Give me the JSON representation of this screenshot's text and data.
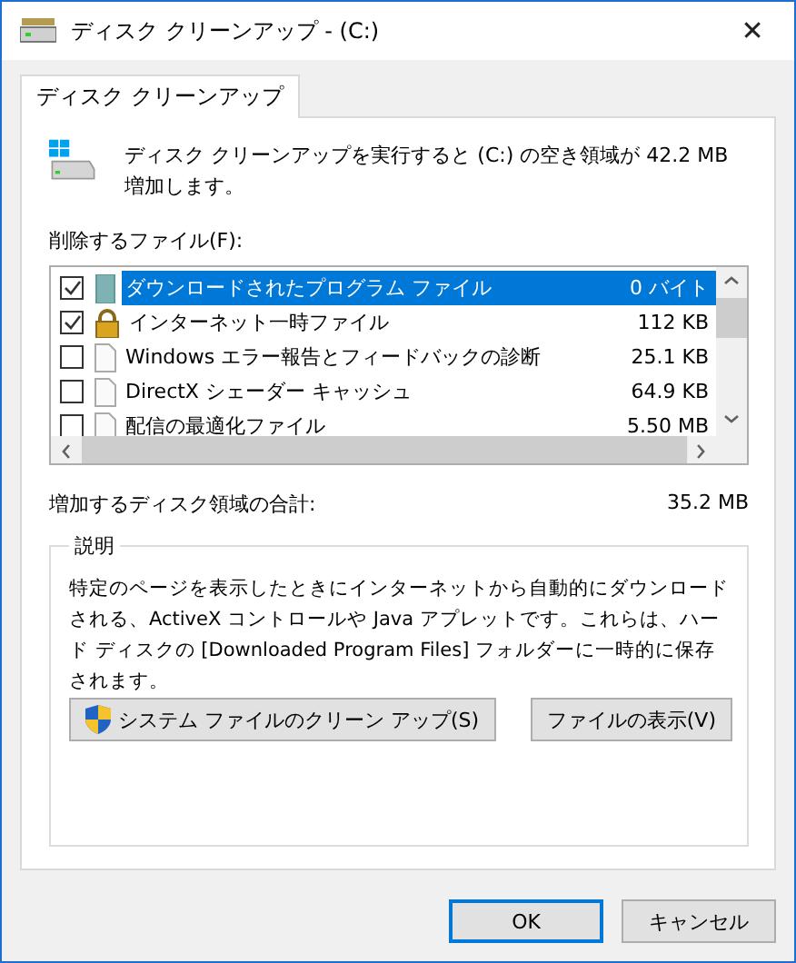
{
  "window": {
    "title": "ディスク クリーンアップ - (C:)",
    "close": "✕"
  },
  "tabs": [
    {
      "label": "ディスク クリーンアップ",
      "selected": true
    }
  ],
  "summary": "ディスク クリーンアップを実行すると (C:) の空き領域が 42.2 MB 増加します。",
  "files_label": "削除するファイル(F):",
  "files": [
    {
      "name": "ダウンロードされたプログラム ファイル",
      "size": "0 バイト",
      "checked": true,
      "selected": true,
      "kind": "program"
    },
    {
      "name": "インターネット一時ファイル",
      "size": "112 KB",
      "checked": true,
      "selected": false,
      "kind": "lock"
    },
    {
      "name": "Windows エラー報告とフィードバックの診断",
      "size": "25.1 KB",
      "checked": false,
      "selected": false,
      "kind": "file"
    },
    {
      "name": "DirectX シェーダー キャッシュ",
      "size": "64.9 KB",
      "checked": false,
      "selected": false,
      "kind": "file"
    },
    {
      "name": "配信の最適化ファイル",
      "size": "5.50 MB",
      "checked": false,
      "selected": false,
      "kind": "file"
    }
  ],
  "total": {
    "label": "増加するディスク領域の合計:",
    "value": "35.2 MB"
  },
  "description": {
    "label": "説明",
    "text": "特定のページを表示したときにインターネットから自動的にダウンロードされる、ActiveX コントロールや Java アプレットです。これらは、ハード ディスクの [Downloaded Program Files] フォルダーに一時的に保存されます。"
  },
  "panel_buttons": [
    {
      "label": "システム ファイルのクリーン アップ(S)",
      "kind": "shield"
    },
    {
      "label": "ファイルの表示(V)",
      "kind": "plain"
    }
  ],
  "dialog_buttons": [
    {
      "label": "OK",
      "default": true
    },
    {
      "label": "キャンセル",
      "default": false
    }
  ]
}
